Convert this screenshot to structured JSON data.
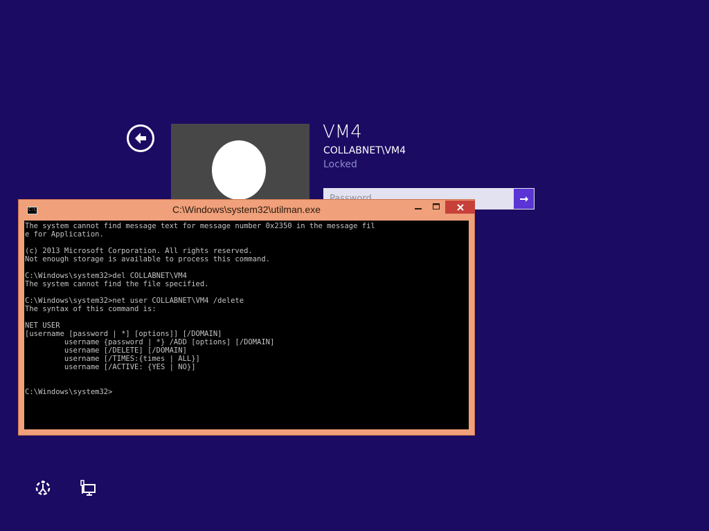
{
  "user": {
    "name": "VM4",
    "domain_account": "COLLABNET\\VM4",
    "status": "Locked"
  },
  "password": {
    "placeholder": "Password",
    "value": ""
  },
  "icons": {
    "back": "arrow-left-circle-icon",
    "submit": "arrow-right-icon",
    "ease_of_access": "ease-of-access-icon",
    "network": "network-icon"
  },
  "cmd": {
    "title": "C:\\Windows\\system32\\utilman.exe",
    "icon_label": "C:\\",
    "lines": [
      "The system cannot find message text for message number 0x2350 in the message fil",
      "e for Application.",
      "",
      "(c) 2013 Microsoft Corporation. All rights reserved.",
      "Not enough storage is available to process this command.",
      "",
      "C:\\Windows\\system32>del COLLABNET\\VM4",
      "The system cannot find the file specified.",
      "",
      "C:\\Windows\\system32>net user COLLABNET\\VM4 /delete",
      "The syntax of this command is:",
      "",
      "NET USER",
      "[username [password | *] [options]] [/DOMAIN]",
      "         username {password | *} /ADD [options] [/DOMAIN]",
      "         username [/DELETE] [/DOMAIN]",
      "         username [/TIMES:{times | ALL}]",
      "         username [/ACTIVE: {YES | NO}]",
      "",
      "",
      "C:\\Windows\\system32>"
    ]
  },
  "colors": {
    "background": "#1c0b63",
    "window_frame": "#f0a07a",
    "close_button": "#c7413a",
    "submit_button": "#5a34d4",
    "console_text": "#c4c4c4"
  }
}
